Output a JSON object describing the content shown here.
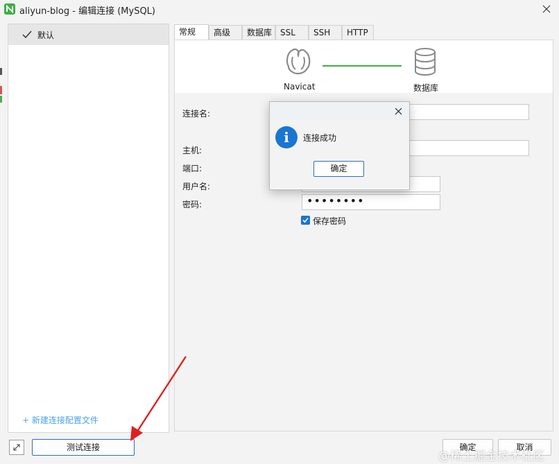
{
  "window": {
    "title": "aliyun-blog - 编辑连接 (MySQL)"
  },
  "sidebar": {
    "profiles": [
      {
        "label": "默认",
        "selected": true
      }
    ],
    "new_profile_link": "+ 新建连接配置文件"
  },
  "tabs": [
    {
      "label": "常规",
      "active": true
    },
    {
      "label": "高级",
      "active": false
    },
    {
      "label": "数据库",
      "active": false
    },
    {
      "label": "SSL",
      "active": false
    },
    {
      "label": "SSH",
      "active": false
    },
    {
      "label": "HTTP",
      "active": false
    }
  ],
  "banner": {
    "client_label": "Navicat",
    "server_label": "数据库",
    "line_color": "#3cb043"
  },
  "form": {
    "connection_name_label": "连接名:",
    "host_label": "主机:",
    "port_label": "端口:",
    "username_label": "用户名:",
    "password_label": "密码:",
    "password_value": "••••••••",
    "save_password_label": "保存密码",
    "save_password_checked": true
  },
  "dialog": {
    "message": "连接成功",
    "ok_label": "确定",
    "icon": "info-icon"
  },
  "footer": {
    "test_connection": "测试连接",
    "ok": "确定",
    "cancel": "取消"
  },
  "watermark": "@稀土掘金技术社区",
  "colors": {
    "accent": "#1976d2",
    "link": "#4aa3e8",
    "arrow": "#e02020"
  }
}
